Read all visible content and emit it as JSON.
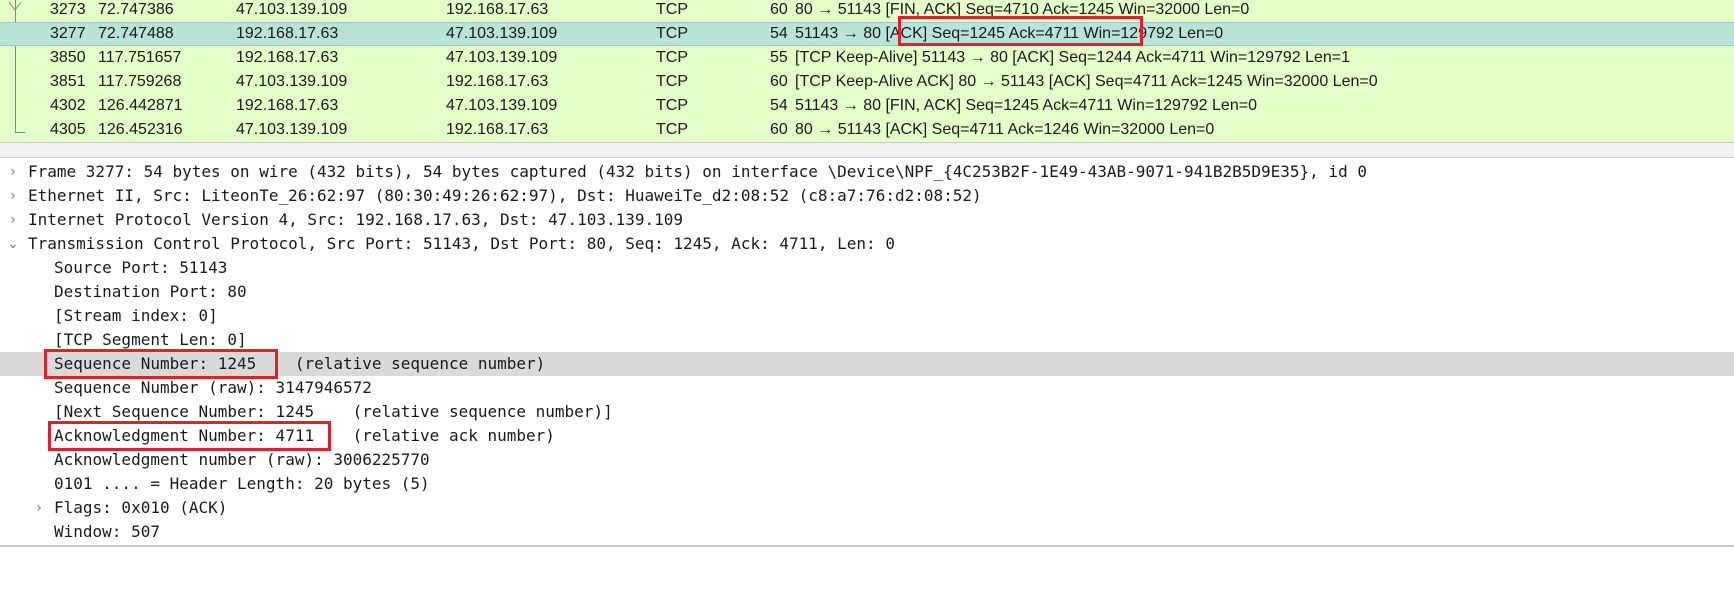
{
  "packets": [
    {
      "no": "3273",
      "time": "72.747386",
      "src": "47.103.139.109",
      "dst": "192.168.17.63",
      "proto": "TCP",
      "len": "60",
      "info": "80 → 51143 [FIN, ACK] Seq=4710 Ack=1245 Win=32000 Len=0"
    },
    {
      "no": "3277",
      "time": "72.747488",
      "src": "192.168.17.63",
      "dst": "47.103.139.109",
      "proto": "TCP",
      "len": "54",
      "info": "51143 → 80 [ACK] Seq=1245 Ack=4711 Win=129792 Len=0"
    },
    {
      "no": "3850",
      "time": "117.751657",
      "src": "192.168.17.63",
      "dst": "47.103.139.109",
      "proto": "TCP",
      "len": "55",
      "info": "[TCP Keep-Alive] 51143 → 80 [ACK] Seq=1244 Ack=4711 Win=129792 Len=1"
    },
    {
      "no": "3851",
      "time": "117.759268",
      "src": "47.103.139.109",
      "dst": "192.168.17.63",
      "proto": "TCP",
      "len": "60",
      "info": "[TCP Keep-Alive ACK] 80 → 51143 [ACK] Seq=4711 Ack=1245 Win=32000 Len=0"
    },
    {
      "no": "4302",
      "time": "126.442871",
      "src": "192.168.17.63",
      "dst": "47.103.139.109",
      "proto": "TCP",
      "len": "54",
      "info": "51143 → 80 [FIN, ACK] Seq=1245 Ack=4711 Win=129792 Len=0"
    },
    {
      "no": "4305",
      "time": "126.452316",
      "src": "47.103.139.109",
      "dst": "192.168.17.63",
      "proto": "TCP",
      "len": "60",
      "info": "80 → 51143 [ACK] Seq=4711 Ack=1246 Win=32000 Len=0"
    }
  ],
  "details": [
    {
      "arrow": "›",
      "text": "Frame 3277: 54 bytes on wire (432 bits), 54 bytes captured (432 bits) on interface \\Device\\NPF_{4C253B2F-1E49-43AB-9071-941B2B5D9E35}, id 0"
    },
    {
      "arrow": "›",
      "text": "Ethernet II, Src: LiteonTe_26:62:97 (80:30:49:26:62:97), Dst: HuaweiTe_d2:08:52 (c8:a7:76:d2:08:52)"
    },
    {
      "arrow": "›",
      "text": "Internet Protocol Version 4, Src: 192.168.17.63, Dst: 47.103.139.109"
    },
    {
      "arrow": "⌄",
      "text": "Transmission Control Protocol, Src Port: 51143, Dst Port: 80, Seq: 1245, Ack: 4711, Len: 0"
    },
    {
      "arrow": "",
      "text": "Source Port: 51143"
    },
    {
      "arrow": "",
      "text": "Destination Port: 80"
    },
    {
      "arrow": "",
      "text": "[Stream index: 0]"
    },
    {
      "arrow": "",
      "text": "[TCP Segment Len: 0]"
    },
    {
      "arrow": "",
      "text": "Sequence Number: 1245    (relative sequence number)"
    },
    {
      "arrow": "",
      "text": "Sequence Number (raw): 3147946572"
    },
    {
      "arrow": "",
      "text": "[Next Sequence Number: 1245    (relative sequence number)]"
    },
    {
      "arrow": "",
      "text": "Acknowledgment Number: 4711    (relative ack number)"
    },
    {
      "arrow": "",
      "text": "Acknowledgment number (raw): 3006225770"
    },
    {
      "arrow": "",
      "text": "0101 .... = Header Length: 20 bytes (5)"
    },
    {
      "arrow": "›",
      "text": "Flags: 0x010 (ACK)"
    },
    {
      "arrow": "",
      "text": "Window: 507"
    }
  ],
  "colors": {
    "packet_list_bg": "#e4ffc7",
    "selected_row_bg": "#b7e3d8",
    "highlight_row_bg": "#d9d9d9",
    "annotation_box": "#e0202a"
  }
}
